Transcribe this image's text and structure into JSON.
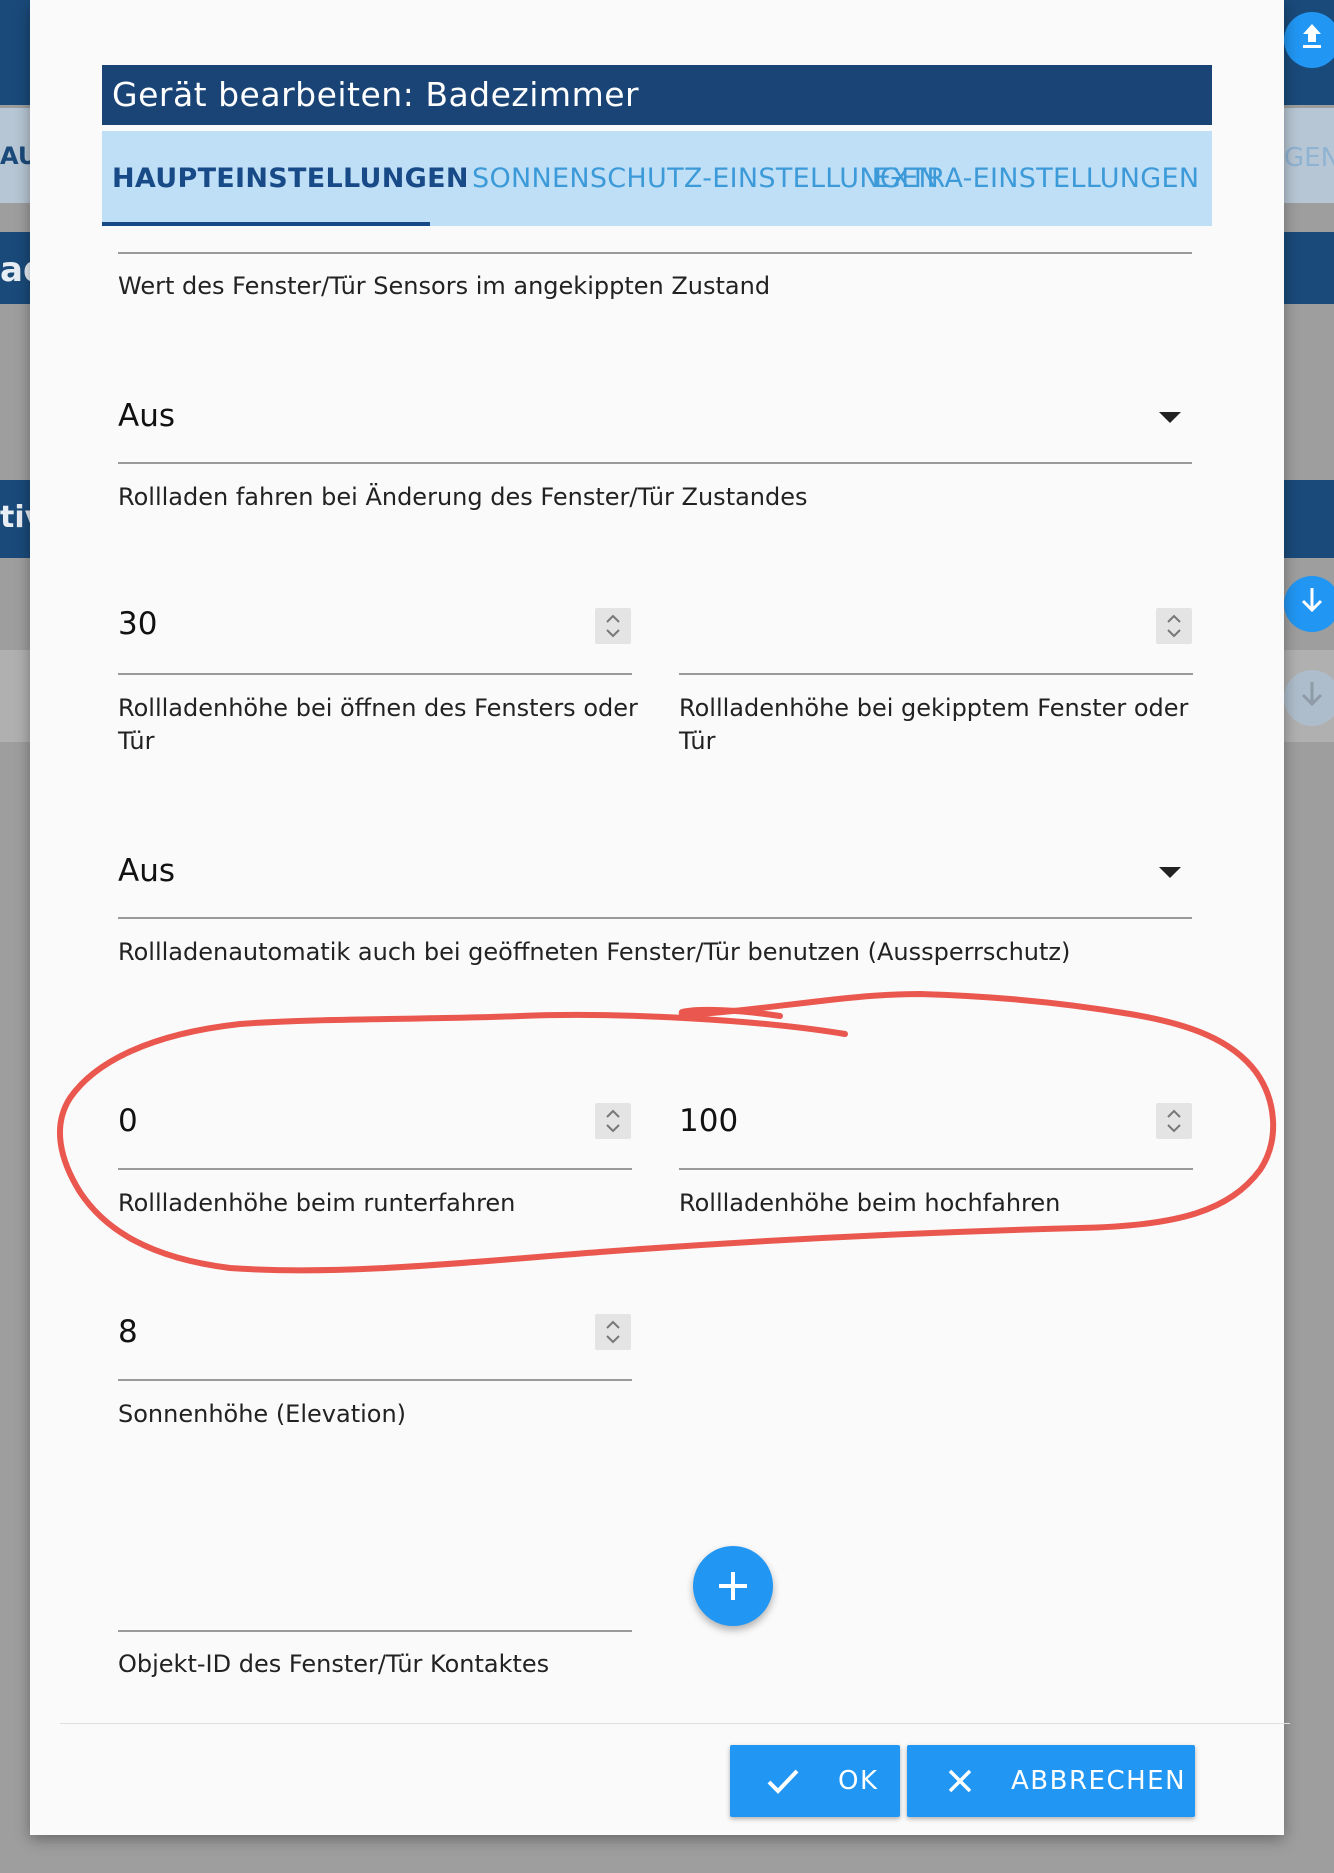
{
  "background": {
    "text_1": "AU",
    "text_2": "ad",
    "text_3": "tiv",
    "text_4": "GEN"
  },
  "dialog": {
    "title": "Gerät bearbeiten: Badezimmer",
    "tabs": [
      {
        "label": "HAUPTEINSTELLUNGEN",
        "active": true
      },
      {
        "label": "SONNENSCHUTZ-EINSTELLUNGEN",
        "active": false
      },
      {
        "label": "EXTRA-EINSTELLUNGEN",
        "active": false
      }
    ],
    "fields": {
      "tilted_sensor_label": "Wert des Fenster/Tür Sensors im angekippten Zustand",
      "move_on_change_value": "Aus",
      "move_on_change_label": "Rollladen fahren bei Änderung des Fenster/Tür Zustandes",
      "height_open_value": "30",
      "height_open_label_line1": "Rollladenhöhe bei öffnen des Fensters oder",
      "height_open_label_line2": "Tür",
      "height_tilted_value": "",
      "height_tilted_label_line1": "Rollladenhöhe bei gekipptem Fenster oder",
      "height_tilted_label_line2": "Tür",
      "lockout_value": "Aus",
      "lockout_label": "Rollladenautomatik auch bei geöffneten Fenster/Tür benutzen (Aussperrschutz)",
      "height_down_value": "0",
      "height_down_label": "Rollladenhöhe beim runterfahren",
      "height_up_value": "100",
      "height_up_label": "Rollladenhöhe beim hochfahren",
      "elevation_value": "8",
      "elevation_label": "Sonnenhöhe (Elevation)",
      "contact_id_label": "Objekt-ID des Fenster/Tür Kontaktes"
    },
    "buttons": {
      "ok_label": "OK",
      "cancel_label": "ABBRECHEN"
    }
  },
  "colors": {
    "title_bar": "#1a4475",
    "tab_bar": "#bfdff7",
    "accent": "#2196f3",
    "annotation": "#e8453c"
  }
}
